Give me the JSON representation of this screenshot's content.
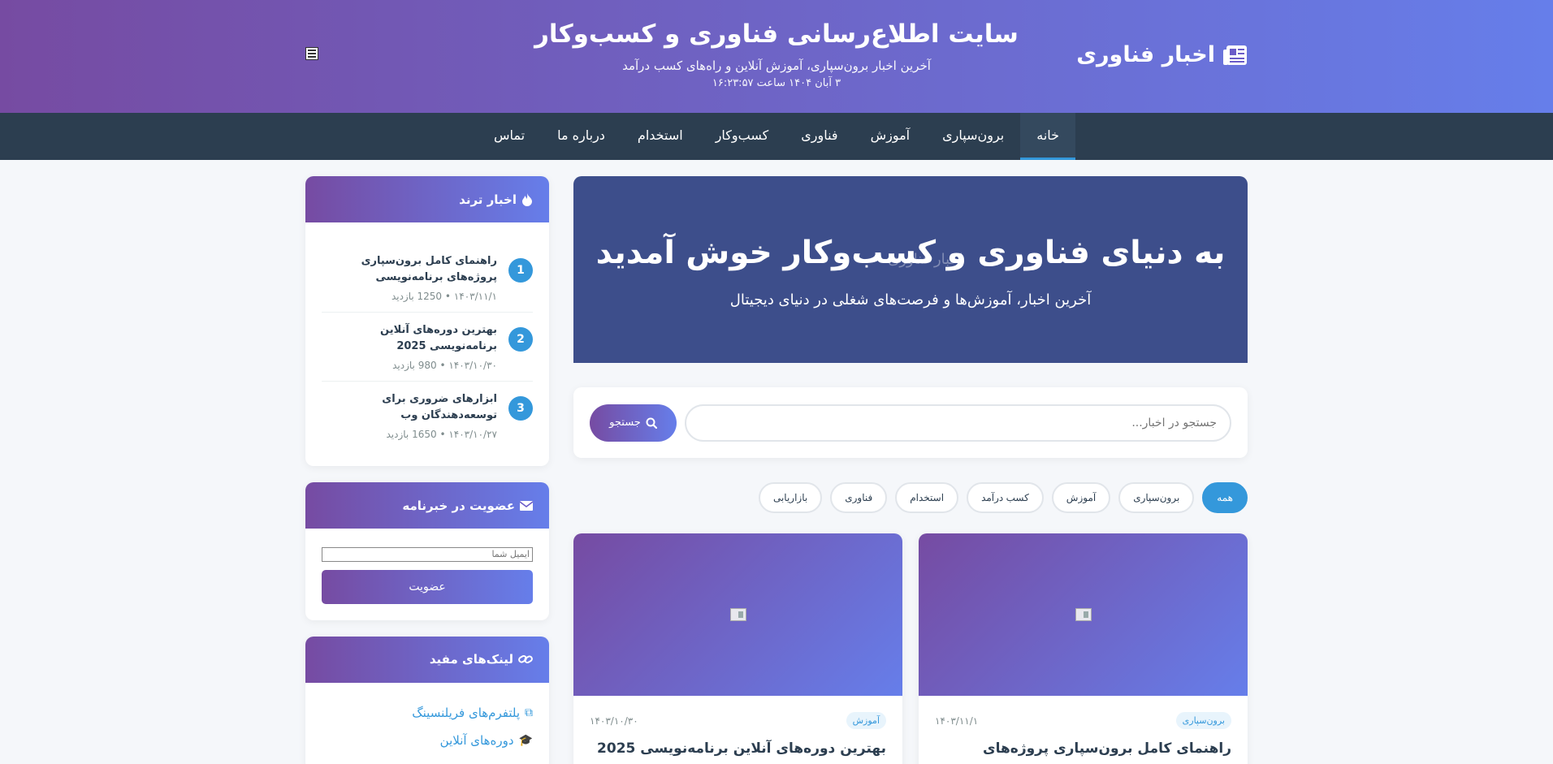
{
  "header": {
    "logo_text": "اخبار فناوری",
    "site_title": "سایت اطلاع‌رسانی فناوری و کسب‌وکار",
    "tagline": "آخرین اخبار برون‌سپاری، آموزش آنلاین و راه‌های کسب درآمد",
    "date_line": "۳ آبان ۱۴۰۴ ساعت ۱۶:۲۳:۵۷"
  },
  "nav": {
    "items": [
      "خانه",
      "برون‌سپاری",
      "آموزش",
      "فناوری",
      "کسب‌وکار",
      "استخدام",
      "درباره ما",
      "تماس"
    ],
    "active": "خانه"
  },
  "hero": {
    "title": "به دنیای فناوری و کسب‌وکار خوش آمدید",
    "ghost_text": "اخبار فناوری",
    "subtitle": "آخرین اخبار، آموزش‌ها و فرصت‌های شغلی در دنیای دیجیتال"
  },
  "search": {
    "placeholder": "جستجو در اخبار...",
    "button_label": "جستجو"
  },
  "filters": {
    "items": [
      "همه",
      "برون‌سپاری",
      "آموزش",
      "کسب درآمد",
      "استخدام",
      "فناوری",
      "بازاریابی"
    ],
    "active": "همه"
  },
  "cards": [
    {
      "tag": "برون‌سپاری",
      "date": "۱۴۰۳/۱۱/۱",
      "title": "راهنمای کامل برون‌سپاری پروژه‌های"
    },
    {
      "tag": "آموزش",
      "date": "۱۴۰۳/۱۰/۳۰",
      "title": "بهترین دوره‌های آنلاین برنامه‌نویسی 2025"
    }
  ],
  "sidebar": {
    "trending": {
      "heading": "اخبار ترند",
      "items": [
        {
          "num": "1",
          "title": "راهنمای کامل برون‌سپاری پروژه‌های برنامه‌نویسی",
          "meta": "۱۴۰۳/۱۱/۱ • 1250 بازدید"
        },
        {
          "num": "2",
          "title": "بهترین دوره‌های آنلاین برنامه‌نویسی 2025",
          "meta": "۱۴۰۳/۱۰/۳۰ • 980 بازدید"
        },
        {
          "num": "3",
          "title": "ابزارهای ضروری برای توسعه‌دهندگان وب",
          "meta": "۱۴۰۳/۱۰/۲۷ • 1650 بازدید"
        }
      ]
    },
    "newsletter": {
      "heading": "عضویت در خبرنامه",
      "placeholder": "ایمیل شما",
      "button_label": "عضویت"
    },
    "links": {
      "heading": "لینک‌های مفید",
      "items": [
        {
          "label": "پلتفرم‌های فریلنسینگ",
          "icon": "external-link-icon"
        },
        {
          "label": "دوره‌های آنلاین",
          "icon": "graduation-cap-icon"
        }
      ]
    }
  },
  "colors": {
    "header_gradient_start": "#667eea",
    "header_gradient_end": "#764ba2",
    "nav_bg": "#2c3e50",
    "accent": "#3498db",
    "hero_bg": "#3d4e8b"
  }
}
